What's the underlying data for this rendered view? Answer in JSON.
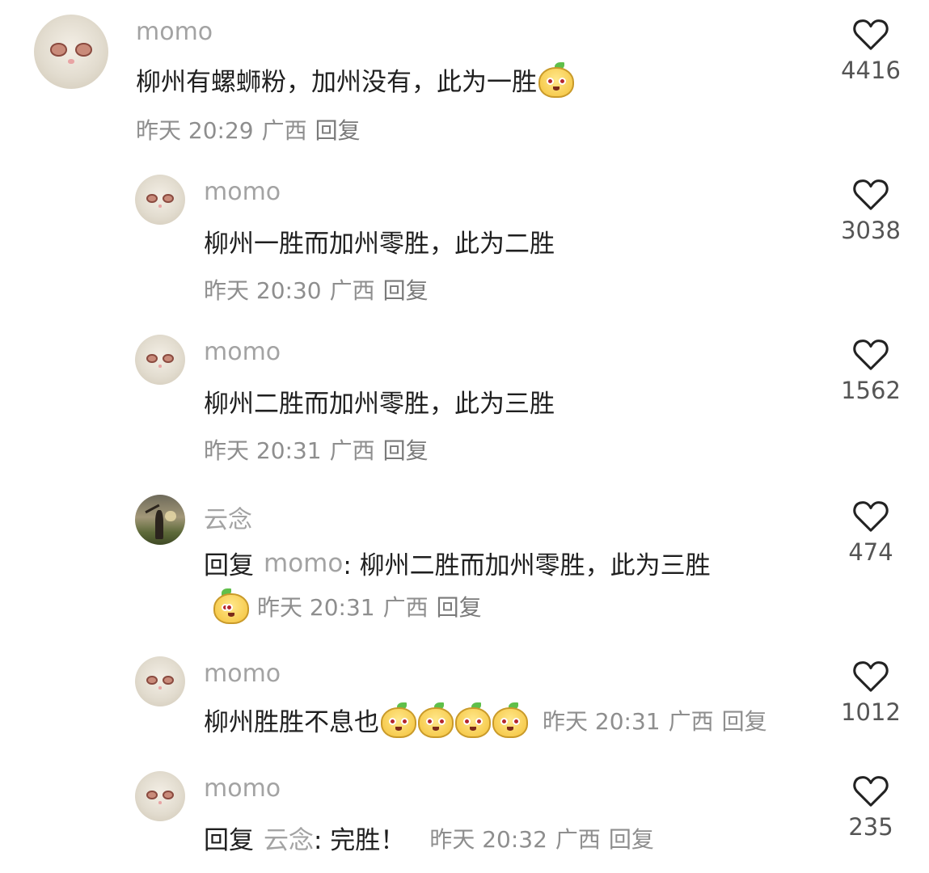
{
  "comments": [
    {
      "user": "momo",
      "text": "柳州有螺蛳粉，加州没有，此为一胜",
      "time": "昨天 20:29",
      "location": "广西",
      "reply_label": "回复",
      "likes": "4416"
    },
    {
      "user": "momo",
      "text": "柳州一胜而加州零胜，此为二胜",
      "time": "昨天 20:30",
      "location": "广西",
      "reply_label": "回复",
      "likes": "3038"
    },
    {
      "user": "momo",
      "text": "柳州二胜而加州零胜，此为三胜",
      "time": "昨天 20:31",
      "location": "广西",
      "reply_label": "回复",
      "likes": "1562"
    },
    {
      "user": "云念",
      "reply_prefix": "回复",
      "mention": "momo",
      "text": ": 柳州二胜而加州零胜，此为三胜",
      "time": "昨天 20:31",
      "location": "广西",
      "reply_label": "回复",
      "likes": "474"
    },
    {
      "user": "momo",
      "text": "柳州胜胜不息也",
      "time": "昨天 20:31",
      "location": "广西",
      "reply_label": "回复",
      "likes": "1012"
    },
    {
      "user": "momo",
      "reply_prefix": "回复",
      "mention": "云念",
      "text": ": 完胜！",
      "time": "昨天 20:32",
      "location": "广西",
      "reply_label": "回复",
      "likes": "235"
    }
  ],
  "icons": {
    "like": "heart-outline-icon",
    "sticker": "mango-face-sticker-icon"
  }
}
